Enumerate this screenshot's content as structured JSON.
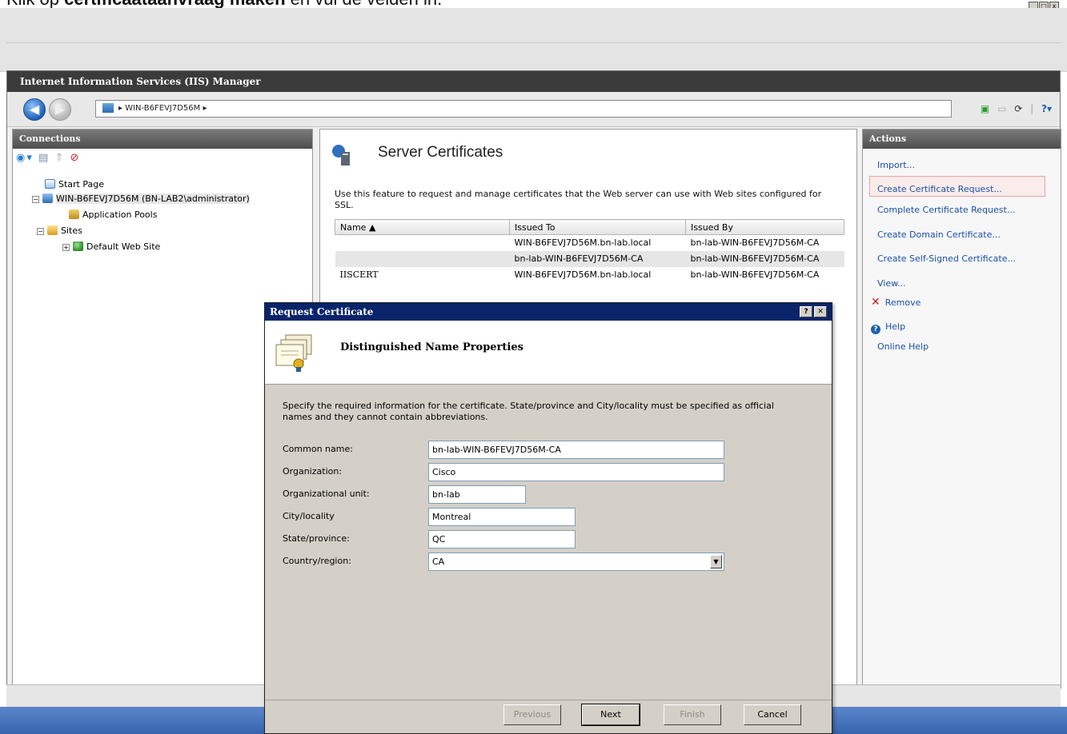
{
  "caption": {
    "prefix": "Klik op ",
    "bold": "certificaataanvraag maken",
    "suffix": " en vul de velden in."
  },
  "window": {
    "title": "Internet Information Services (IIS) Manager"
  },
  "nav": {
    "address_server": "WIN-B6FEVJ7D56M"
  },
  "connections": {
    "title": "Connections",
    "tree": [
      {
        "label": "Start Page"
      },
      {
        "label": "WIN-B6FEVJ7D56M (BN-LAB2\\administrator)"
      },
      {
        "label": "Application Pools"
      },
      {
        "label": "Sites"
      },
      {
        "label": "Default Web Site"
      }
    ]
  },
  "center": {
    "title": "Server Certificates",
    "description": "Use this feature to request and manage certificates that the Web server can use with Web sites configured for SSL.",
    "columns": [
      "Name ▲",
      "Issued To",
      "Issued By"
    ],
    "rows": [
      [
        "",
        "WIN-B6FEVJ7D56M.bn-lab.local",
        "bn-lab-WIN-B6FEVJ7D56M-CA"
      ],
      [
        "",
        "bn-lab-WIN-B6FEVJ7D56M-CA",
        "bn-lab-WIN-B6FEVJ7D56M-CA"
      ],
      [
        "IISCERT",
        "WIN-B6FEVJ7D56M.bn-lab.local",
        "bn-lab-WIN-B6FEVJ7D56M-CA"
      ]
    ]
  },
  "actions": {
    "title": "Actions",
    "import": "Import...",
    "create_request": "Create Certificate Request...",
    "complete_request": "Complete Certificate Request...",
    "create_domain": "Create Domain Certificate...",
    "create_self_signed": "Create Self-Signed Certificate...",
    "view": "View...",
    "remove": "Remove",
    "help": "Help",
    "online_help": "Online Help"
  },
  "dialog": {
    "title": "Request Certificate",
    "help_btn": "?",
    "close_btn": "✕",
    "heading": "Distinguished Name Properties",
    "description": "Specify the required information for the certificate. State/province and City/locality must be specified as official names and they cannot contain abbreviations.",
    "fields": {
      "common_name": {
        "label": "Common name:",
        "value": "bn-lab-WIN-B6FEVJ7D56M-CA"
      },
      "organization": {
        "label": "Organization:",
        "value": "Cisco"
      },
      "org_unit": {
        "label": "Organizational unit:",
        "value": "bn-lab"
      },
      "city": {
        "label": "City/locality",
        "value": "Montreal"
      },
      "state": {
        "label": "State/province:",
        "value": "QC"
      },
      "country": {
        "label": "Country/region:",
        "value": "CA"
      }
    },
    "buttons": {
      "previous": "Previous",
      "next": "Next",
      "finish": "Finish",
      "cancel": "Cancel"
    }
  }
}
